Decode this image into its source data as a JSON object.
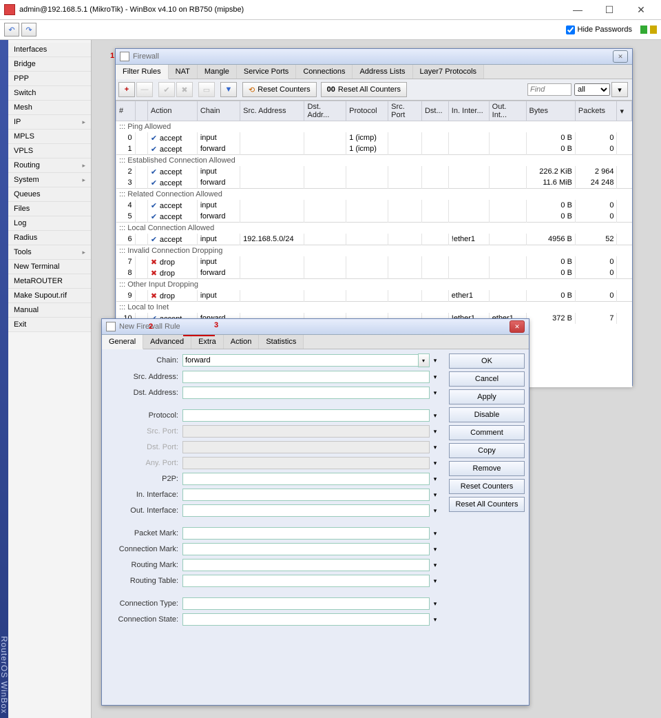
{
  "window": {
    "title": "admin@192.168.5.1 (MikroTik) - WinBox v4.10 on RB750 (mipsbe)"
  },
  "toolbar": {
    "hidepw": "Hide Passwords"
  },
  "leftrail": "RouterOS WinBox",
  "menu": [
    {
      "label": "Interfaces"
    },
    {
      "label": "Bridge"
    },
    {
      "label": "PPP"
    },
    {
      "label": "Switch"
    },
    {
      "label": "Mesh"
    },
    {
      "label": "IP",
      "arrow": true
    },
    {
      "label": "MPLS"
    },
    {
      "label": "VPLS"
    },
    {
      "label": "Routing",
      "arrow": true
    },
    {
      "label": "System",
      "arrow": true
    },
    {
      "label": "Queues"
    },
    {
      "label": "Files"
    },
    {
      "label": "Log"
    },
    {
      "label": "Radius"
    },
    {
      "label": "Tools",
      "arrow": true
    },
    {
      "label": "New Terminal"
    },
    {
      "label": "MetaROUTER"
    },
    {
      "label": "Make Supout.rif"
    },
    {
      "label": "Manual"
    },
    {
      "label": "Exit"
    }
  ],
  "firewall": {
    "title": "Firewall",
    "tabs": [
      "Filter Rules",
      "NAT",
      "Mangle",
      "Service Ports",
      "Connections",
      "Address Lists",
      "Layer7 Protocols"
    ],
    "activeTab": 0,
    "btn_reset": "Reset Counters",
    "btn_reset_all": "Reset All Counters",
    "find_ph": "Find",
    "filter_opt": "all",
    "columns": [
      "#",
      "",
      "Action",
      "Chain",
      "Src. Address",
      "Dst. Addr...",
      "Protocol",
      "Src. Port",
      "Dst...",
      "In. Inter...",
      "Out. Int...",
      "Bytes",
      "Packets"
    ],
    "rows": [
      {
        "sect": "::: Ping Allowed"
      },
      {
        "n": "0",
        "act": "accept",
        "chain": "input",
        "proto": "1 (icmp)",
        "bytes": "0 B",
        "pkts": "0"
      },
      {
        "n": "1",
        "act": "accept",
        "chain": "forward",
        "proto": "1 (icmp)",
        "bytes": "0 B",
        "pkts": "0"
      },
      {
        "sect": "::: Established Connection Allowed"
      },
      {
        "n": "2",
        "act": "accept",
        "chain": "input",
        "bytes": "226.2 KiB",
        "pkts": "2 964"
      },
      {
        "n": "3",
        "act": "accept",
        "chain": "forward",
        "bytes": "11.6 MiB",
        "pkts": "24 248"
      },
      {
        "sect": "::: Related Connection Allowed"
      },
      {
        "n": "4",
        "act": "accept",
        "chain": "input",
        "bytes": "0 B",
        "pkts": "0"
      },
      {
        "n": "5",
        "act": "accept",
        "chain": "forward",
        "bytes": "0 B",
        "pkts": "0"
      },
      {
        "sect": "::: Local Connection Allowed"
      },
      {
        "n": "6",
        "act": "accept",
        "chain": "input",
        "src": "192.168.5.0/24",
        "inif": "!ether1",
        "bytes": "4956 B",
        "pkts": "52"
      },
      {
        "sect": "::: Invalid Connection Dropping"
      },
      {
        "n": "7",
        "act": "drop",
        "chain": "input",
        "bytes": "0 B",
        "pkts": "0"
      },
      {
        "n": "8",
        "act": "drop",
        "chain": "forward",
        "bytes": "0 B",
        "pkts": "0"
      },
      {
        "sect": "::: Other Input Dropping"
      },
      {
        "n": "9",
        "act": "drop",
        "chain": "input",
        "inif": "ether1",
        "bytes": "0 B",
        "pkts": "0"
      },
      {
        "sect": "::: Local to Inet"
      },
      {
        "n": "10",
        "act": "accept",
        "chain": "forward",
        "inif": "!ether1",
        "outif": "ether1",
        "bytes": "372 B",
        "pkts": "7"
      }
    ]
  },
  "annotations": {
    "one": "1",
    "two": "2",
    "three": "3"
  },
  "dialog": {
    "title": "New Firewall Rule",
    "tabs": [
      "General",
      "Advanced",
      "Extra",
      "Action",
      "Statistics"
    ],
    "activeTab": 0,
    "fields": {
      "chain": {
        "label": "Chain:",
        "value": "forward"
      },
      "src": {
        "label": "Src. Address:"
      },
      "dst": {
        "label": "Dst. Address:"
      },
      "proto": {
        "label": "Protocol:"
      },
      "srcport": {
        "label": "Src. Port:",
        "dis": true
      },
      "dstport": {
        "label": "Dst. Port:",
        "dis": true
      },
      "anyport": {
        "label": "Any. Port:",
        "dis": true
      },
      "p2p": {
        "label": "P2P:"
      },
      "inif": {
        "label": "In. Interface:"
      },
      "outif": {
        "label": "Out. Interface:"
      },
      "pmark": {
        "label": "Packet Mark:"
      },
      "cmark": {
        "label": "Connection Mark:"
      },
      "rmark": {
        "label": "Routing Mark:"
      },
      "rtable": {
        "label": "Routing Table:"
      },
      "ctype": {
        "label": "Connection Type:"
      },
      "cstate": {
        "label": "Connection State:"
      }
    },
    "buttons": [
      "OK",
      "Cancel",
      "Apply",
      "Disable",
      "Comment",
      "Copy",
      "Remove",
      "Reset Counters",
      "Reset All Counters"
    ]
  }
}
